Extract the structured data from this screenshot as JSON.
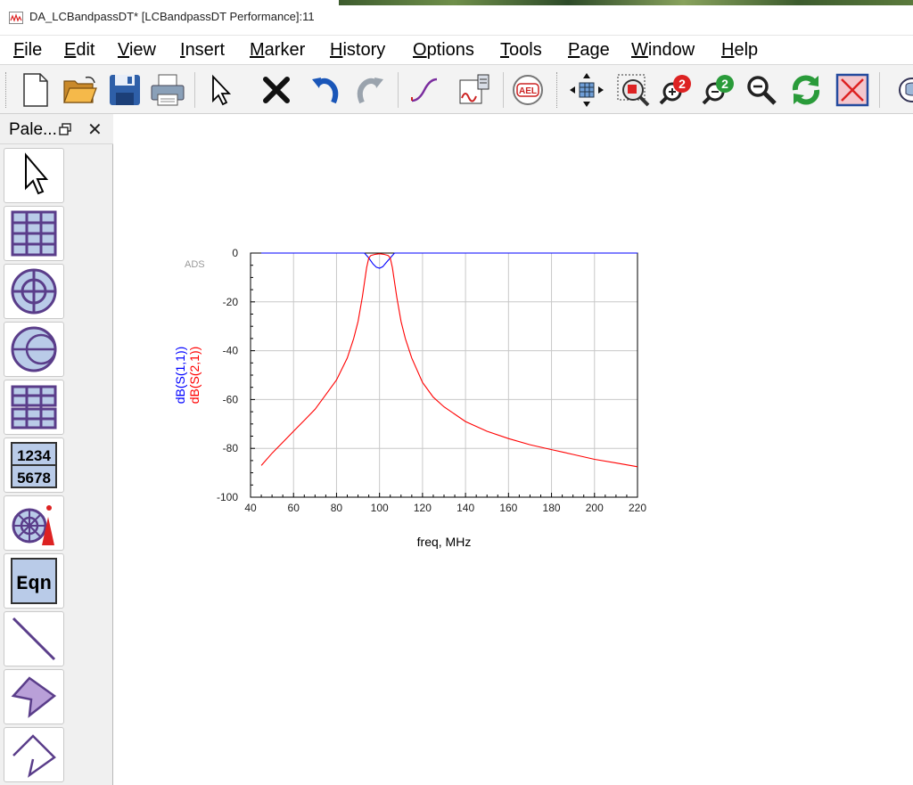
{
  "window": {
    "title": "DA_LCBandpassDT* [LCBandpassDT Performance]:11"
  },
  "menu": [
    {
      "label": "File",
      "u": "F",
      "rest": "ile"
    },
    {
      "label": "Edit",
      "u": "E",
      "rest": "dit"
    },
    {
      "label": "View",
      "u": "V",
      "rest": "iew"
    },
    {
      "label": "Insert",
      "u": "I",
      "rest": "nsert"
    },
    {
      "label": "Marker",
      "u": "M",
      "rest": "arker"
    },
    {
      "label": "History",
      "u": "H",
      "rest": "istory"
    },
    {
      "label": "Options",
      "u": "O",
      "rest": "ptions"
    },
    {
      "label": "Tools",
      "u": "T",
      "rest": "ools"
    },
    {
      "label": "Page",
      "u": "P",
      "rest": "age"
    },
    {
      "label": "Window",
      "u": "W",
      "rest": "indow"
    },
    {
      "label": "Help",
      "u": "H",
      "rest": "elp"
    }
  ],
  "toolbar": {
    "icons": [
      "new-document-icon",
      "open-folder-icon",
      "save-icon",
      "print-icon",
      "select-pointer-icon",
      "delete-x-icon",
      "undo-icon",
      "redo-icon",
      "trace-icon",
      "plot-data-icon",
      "ael-icon",
      "move-icon",
      "zoom-area-icon",
      "zoom-in-icon",
      "zoom-out-icon",
      "zoom-fit-icon",
      "refresh-icon",
      "clear-box-icon",
      "database-icon"
    ],
    "ael_label": "AEL",
    "zoom_in_label": "2",
    "zoom_out_label": "2"
  },
  "palette": {
    "title": "Pale...",
    "items": [
      {
        "name": "pointer-tool",
        "icon": "pointer-icon"
      },
      {
        "name": "rectangular-plot",
        "icon": "grid-plot-icon"
      },
      {
        "name": "polar-plot",
        "icon": "polar-plot-icon"
      },
      {
        "name": "smith-chart",
        "icon": "smith-chart-icon"
      },
      {
        "name": "stacked-plot",
        "icon": "stacked-plot-icon"
      },
      {
        "name": "list-table",
        "icon": "list-icon",
        "text1": "1234",
        "text2": "5678"
      },
      {
        "name": "antenna-plot",
        "icon": "antenna-plot-icon"
      },
      {
        "name": "equation",
        "icon": "equation-icon",
        "text": "Eqn"
      },
      {
        "name": "line-tool",
        "icon": "line-icon"
      },
      {
        "name": "polygon-tool",
        "icon": "polygon-icon"
      },
      {
        "name": "polyline-tool",
        "icon": "polyline-icon"
      }
    ]
  },
  "colors": {
    "s11": "#0000ff",
    "s21": "#ff0000",
    "grid": "#c8c8c8",
    "palette_icon": "#7a57a8"
  },
  "chart_data": {
    "type": "line",
    "title": "",
    "watermark": "ADS",
    "xlabel": "freq, MHz",
    "ylabel_lines": [
      "dB(S(1,1))",
      "dB(S(2,1))"
    ],
    "xlim": [
      40,
      220
    ],
    "ylim": [
      -100,
      0
    ],
    "xticks": [
      40,
      60,
      80,
      100,
      120,
      140,
      160,
      180,
      200,
      220
    ],
    "yticks": [
      0,
      -20,
      -40,
      -60,
      -80,
      -100
    ],
    "grid": true,
    "series": [
      {
        "name": "dB(S(1,1))",
        "color": "#0000ff",
        "x": [
          45,
          93,
          95,
          97,
          98.5,
          100,
          101.5,
          103,
          105,
          107,
          220
        ],
        "y": [
          0,
          0,
          -2,
          -4.5,
          -5.8,
          -6.2,
          -5.6,
          -4,
          -2,
          0,
          0
        ]
      },
      {
        "name": "dB(S(2,1))",
        "color": "#ff0000",
        "x": [
          45,
          50,
          55,
          60,
          65,
          70,
          75,
          80,
          85,
          88,
          90,
          92,
          94,
          95,
          96,
          98,
          100,
          102,
          104,
          105,
          106,
          108,
          110,
          112,
          115,
          120,
          125,
          130,
          140,
          150,
          160,
          170,
          180,
          190,
          200,
          210,
          220
        ],
        "y": [
          -87,
          -82,
          -77.5,
          -73,
          -68.5,
          -64,
          -58,
          -52,
          -43,
          -35,
          -28,
          -18,
          -6,
          -2,
          -1,
          -0.5,
          -0.3,
          -0.5,
          -1,
          -2,
          -6,
          -18,
          -28,
          -35,
          -43,
          -53,
          -59,
          -63,
          -69,
          -73,
          -76,
          -78.5,
          -80.5,
          -82.5,
          -84.5,
          -86,
          -87.5
        ]
      }
    ]
  }
}
